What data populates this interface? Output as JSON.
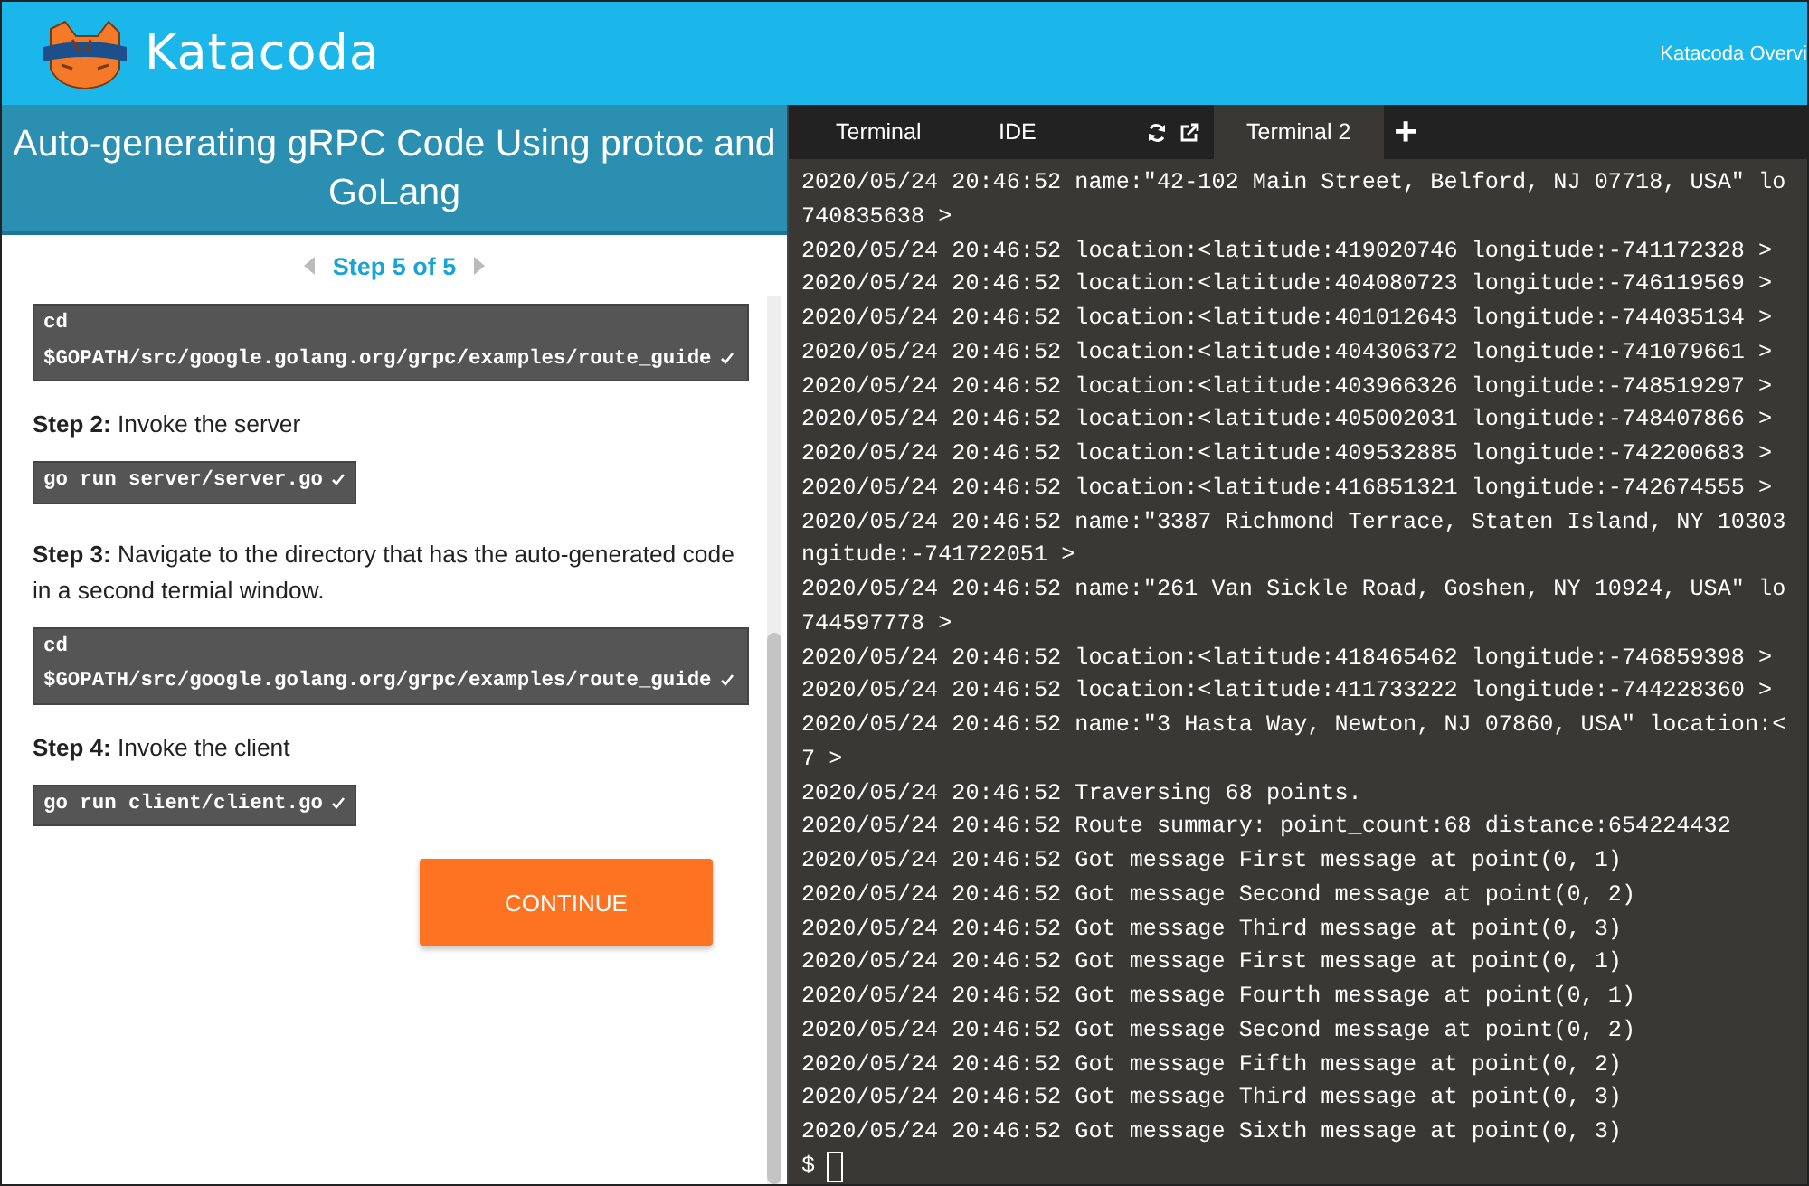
{
  "header": {
    "brand": "Katacoda",
    "nav_link": "Katacoda Overvi"
  },
  "lesson": {
    "title": "Auto-generating gRPC Code Using protoc and GoLang",
    "step_label": "Step 5 of 5",
    "blocks": [
      {
        "kind": "code",
        "command": "cd $GOPATH/src/google.golang.org/grpc/examples/route_guide",
        "done": true
      },
      {
        "kind": "step",
        "label": "Step 2:",
        "text": "Invoke the server"
      },
      {
        "kind": "code",
        "command": "go run server/server.go",
        "done": true
      },
      {
        "kind": "step",
        "label": "Step 3:",
        "text": "Navigate to the directory that has the auto-generated code in a second termial window."
      },
      {
        "kind": "code",
        "command": "cd $GOPATH/src/google.golang.org/grpc/examples/route_guide",
        "done": true
      },
      {
        "kind": "step",
        "label": "Step 4:",
        "text": "Invoke the client"
      },
      {
        "kind": "code",
        "command": "go run client/client.go",
        "done": true
      }
    ],
    "continue_button": "CONTINUE"
  },
  "terminal": {
    "tabs": [
      {
        "label": "Terminal",
        "selected": false
      },
      {
        "label": "IDE",
        "selected": false
      },
      {
        "label": "Terminal 2",
        "selected": true
      }
    ],
    "add_tab": "+",
    "lines": [
      "2020/05/24 20:46:52 name:\"42-102 Main Street, Belford, NJ 07718, USA\" lo",
      "740835638 >",
      "2020/05/24 20:46:52 location:<latitude:419020746 longitude:-741172328 >",
      "2020/05/24 20:46:52 location:<latitude:404080723 longitude:-746119569 >",
      "2020/05/24 20:46:52 location:<latitude:401012643 longitude:-744035134 >",
      "2020/05/24 20:46:52 location:<latitude:404306372 longitude:-741079661 >",
      "2020/05/24 20:46:52 location:<latitude:403966326 longitude:-748519297 >",
      "2020/05/24 20:46:52 location:<latitude:405002031 longitude:-748407866 >",
      "2020/05/24 20:46:52 location:<latitude:409532885 longitude:-742200683 >",
      "2020/05/24 20:46:52 location:<latitude:416851321 longitude:-742674555 >",
      "2020/05/24 20:46:52 name:\"3387 Richmond Terrace, Staten Island, NY 10303",
      "ngitude:-741722051 >",
      "2020/05/24 20:46:52 name:\"261 Van Sickle Road, Goshen, NY 10924, USA\" lo",
      "744597778 >",
      "2020/05/24 20:46:52 location:<latitude:418465462 longitude:-746859398 >",
      "2020/05/24 20:46:52 location:<latitude:411733222 longitude:-744228360 >",
      "2020/05/24 20:46:52 name:\"3 Hasta Way, Newton, NJ 07860, USA\" location:<",
      "7 >",
      "2020/05/24 20:46:52 Traversing 68 points.",
      "2020/05/24 20:46:52 Route summary: point_count:68 distance:654224432",
      "2020/05/24 20:46:52 Got message First message at point(0, 1)",
      "2020/05/24 20:46:52 Got message Second message at point(0, 2)",
      "2020/05/24 20:46:52 Got message Third message at point(0, 3)",
      "2020/05/24 20:46:52 Got message First message at point(0, 1)",
      "2020/05/24 20:46:52 Got message Fourth message at point(0, 1)",
      "2020/05/24 20:46:52 Got message Second message at point(0, 2)",
      "2020/05/24 20:46:52 Got message Fifth message at point(0, 2)",
      "2020/05/24 20:46:52 Got message Third message at point(0, 3)",
      "2020/05/24 20:46:52 Got message Sixth message at point(0, 3)"
    ],
    "prompt": "$"
  }
}
